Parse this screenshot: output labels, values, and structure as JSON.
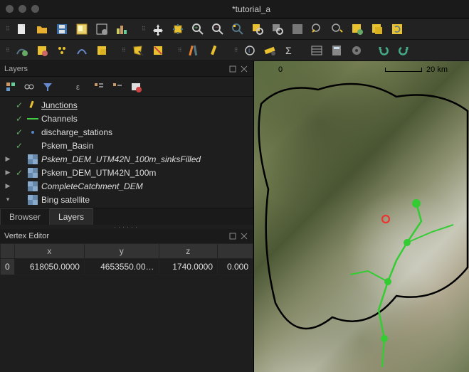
{
  "window": {
    "title": "*tutorial_a"
  },
  "panels": {
    "layers_title": "Layers",
    "vertex_title": "Vertex Editor"
  },
  "tabs": {
    "browser": "Browser",
    "layers": "Layers"
  },
  "layers": [
    {
      "expandable": false,
      "checked": true,
      "symbol": "pencil",
      "label": "Junctions",
      "style": "underline"
    },
    {
      "expandable": false,
      "checked": true,
      "symbol": "line-green",
      "label": "Channels",
      "style": ""
    },
    {
      "expandable": false,
      "checked": true,
      "symbol": "point-blue",
      "label": "discharge_stations",
      "style": ""
    },
    {
      "expandable": false,
      "checked": true,
      "symbol": "blank",
      "label": "Pskem_Basin",
      "style": ""
    },
    {
      "expandable": true,
      "checked": false,
      "symbol": "raster",
      "label": "Pskem_DEM_UTM42N_100m_sinksFilled",
      "style": "italic"
    },
    {
      "expandable": true,
      "checked": true,
      "symbol": "raster",
      "label": "Pskem_DEM_UTM42N_100m",
      "style": ""
    },
    {
      "expandable": true,
      "checked": false,
      "symbol": "raster",
      "label": "CompleteCatchment_DEM",
      "style": "italic"
    },
    {
      "expandable": true,
      "checked": false,
      "symbol": "raster",
      "label": "Bing satellite",
      "style": ""
    }
  ],
  "vertex_table": {
    "headers": [
      "x",
      "y",
      "z",
      ""
    ],
    "rows": [
      {
        "idx": "0",
        "x": "618050.0000",
        "y": "4653550.00…",
        "z": "1740.0000",
        "m": "0.000"
      }
    ]
  },
  "map": {
    "scale_label_left": "0",
    "scale_label_right": "20 km"
  }
}
